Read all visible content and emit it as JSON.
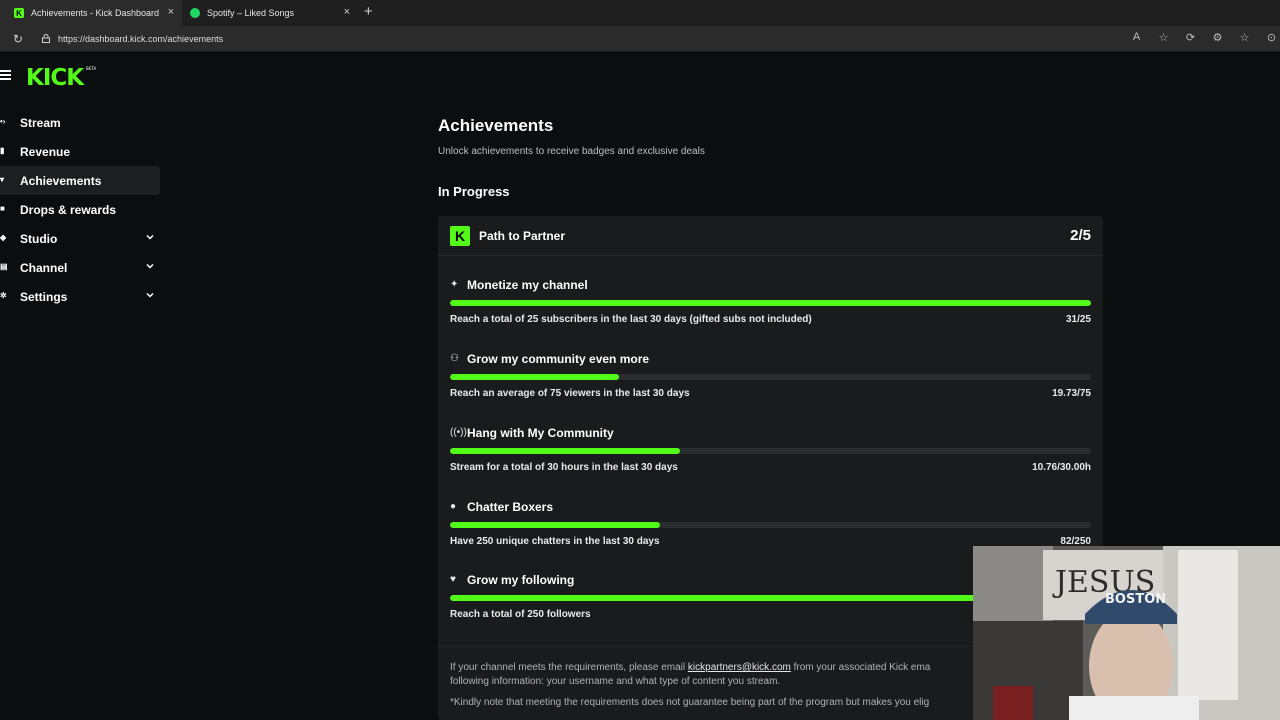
{
  "browser": {
    "tabs": [
      {
        "title": "Achievements - Kick Dashboard",
        "favicon": "kick-icon"
      },
      {
        "title": "Spotify – Liked Songs",
        "favicon": "spotify-icon"
      }
    ],
    "url": "https://dashboard.kick.com/achievements"
  },
  "brand": {
    "logo": "KICK",
    "tag": "BETA",
    "accent": "#53fc18"
  },
  "sidebar": {
    "items": [
      {
        "label": "Stream",
        "icon": "stream-icon"
      },
      {
        "label": "Revenue",
        "icon": "revenue-icon"
      },
      {
        "label": "Achievements",
        "icon": "trophy-icon"
      },
      {
        "label": "Drops & rewards",
        "icon": "gift-icon"
      },
      {
        "label": "Studio",
        "icon": "studio-icon"
      },
      {
        "label": "Channel",
        "icon": "channel-icon"
      },
      {
        "label": "Settings",
        "icon": "gear-icon"
      }
    ]
  },
  "main": {
    "title": "Achievements",
    "subtitle": "Unlock achievements to receive badges and exclusive deals",
    "section": "In Progress",
    "card": {
      "title": "Path to Partner",
      "count": "2/5",
      "achievements": [
        {
          "name": "Monetize my channel",
          "icon": "sparkle-icon",
          "desc": "Reach a total of 25 subscribers in the last 30 days (gifted subs not included)",
          "value": "31/25",
          "progress": 1.0
        },
        {
          "name": "Grow my community even more",
          "icon": "users-icon",
          "desc": "Reach an average of 75 viewers in the last 30 days",
          "value": "19.73/75",
          "progress": 0.263
        },
        {
          "name": "Hang with My Community",
          "icon": "broadcast-icon",
          "desc": "Stream for a total of 30 hours in the last 30 days",
          "value": "10.76/30.00h",
          "progress": 0.359
        },
        {
          "name": "Chatter Boxers",
          "icon": "chat-icon",
          "desc": "Have 250 unique chatters in the last 30 days",
          "value": "82/250",
          "progress": 0.328
        },
        {
          "name": "Grow my following",
          "icon": "heart-icon",
          "desc": "Reach a total of 250 followers",
          "value": "",
          "progress": 1.0
        }
      ],
      "note1_prefix": "If your channel meets the requirements, please email ",
      "note1_link": "kickpartners@kick.com",
      "note1_suffix": " from your associated Kick ema",
      "note2": "following information: your username and what type of content you stream.",
      "note3": "*Kindly note that meeting the requirements does not guarantee being part of the program but makes you elig"
    }
  },
  "webcam": {
    "poster_text": "JESUS",
    "cap_text": "BOSTON"
  }
}
